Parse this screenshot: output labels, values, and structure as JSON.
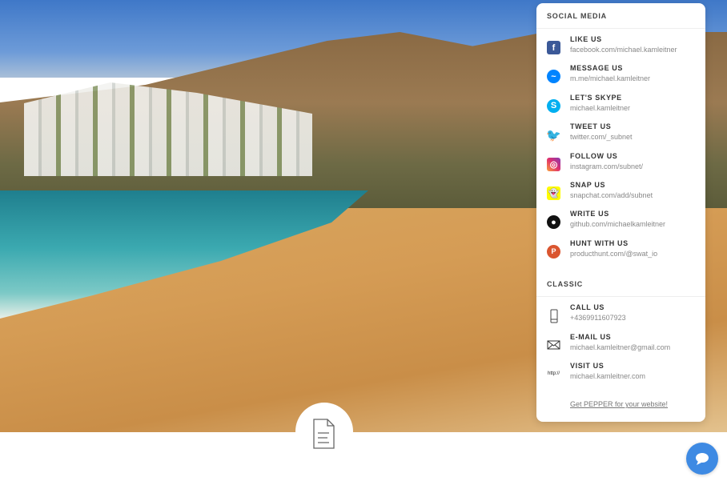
{
  "social": {
    "title": "SOCIAL MEDIA",
    "items": [
      {
        "label": "LIKE US",
        "sub": "facebook.com/michael.kamleitner",
        "icon": "facebook-icon",
        "color": "#3b5998"
      },
      {
        "label": "MESSAGE US",
        "sub": "m.me/michael.kamleitner",
        "icon": "messenger-icon",
        "color": "#0084ff"
      },
      {
        "label": "LET'S SKYPE",
        "sub": "michael.kamleitner",
        "icon": "skype-icon",
        "color": "#00aff0"
      },
      {
        "label": "TWEET US",
        "sub": "twitter.com/_subnet",
        "icon": "twitter-icon",
        "color": "#55acee"
      },
      {
        "label": "FOLLOW US",
        "sub": "instagram.com/subnet/",
        "icon": "instagram-icon",
        "color": "#c13584"
      },
      {
        "label": "SNAP US",
        "sub": "snapchat.com/add/subnet",
        "icon": "snapchat-icon",
        "color": "#fffc00"
      },
      {
        "label": "WRITE US",
        "sub": "github.com/michaelkamleitner",
        "icon": "github-icon",
        "color": "#111111"
      },
      {
        "label": "HUNT WITH US",
        "sub": "producthunt.com/@swat_io",
        "icon": "producthunt-icon",
        "color": "#da552f"
      }
    ]
  },
  "classic": {
    "title": "CLASSIC",
    "items": [
      {
        "label": "CALL US",
        "sub": "+4369911607923",
        "icon": "phone-icon"
      },
      {
        "label": "E-MAIL US",
        "sub": "michael.kamleitner@gmail.com",
        "icon": "mail-icon"
      },
      {
        "label": "VISIT US",
        "sub": "michael.kamleitner.com",
        "icon": "http-icon",
        "glyph": "http://"
      }
    ]
  },
  "footer_link": "Get PEPPER for your website!",
  "chat_color": "#3e8ae3"
}
